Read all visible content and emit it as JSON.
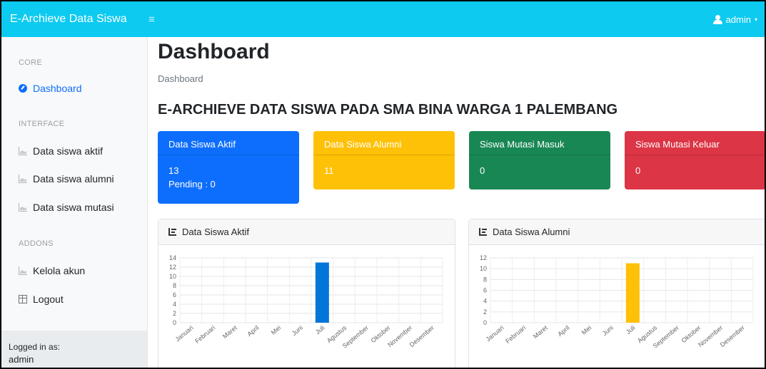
{
  "navbar": {
    "brand": "E-Archieve Data Siswa",
    "toggle_icon": "menu-icon",
    "user_label": "admin",
    "user_icon": "user-icon",
    "caret": "▾"
  },
  "sidebar": {
    "sections": {
      "core": "CORE",
      "interface": "INTERFACE",
      "addons": "ADDONS"
    },
    "items": [
      {
        "label": "Dashboard",
        "icon": "dashboard-icon",
        "active": true
      },
      {
        "label": "Data siswa aktif",
        "icon": "area-chart-icon"
      },
      {
        "label": "Data siswa alumni",
        "icon": "area-chart-icon"
      },
      {
        "label": "Data siswa mutasi",
        "icon": "area-chart-icon"
      },
      {
        "label": "Kelola akun",
        "icon": "area-chart-icon"
      },
      {
        "label": "Logout",
        "icon": "table-icon"
      }
    ],
    "footer": {
      "caption": "Logged in as:",
      "name": "admin"
    }
  },
  "main": {
    "title": "Dashboard",
    "breadcrumb": "Dashboard",
    "headline": "E-ARCHIEVE DATA SISWA PADA SMA BINA WARGA 1 PALEMBANG",
    "cards": [
      {
        "title": "Data Siswa Aktif",
        "value": "13",
        "extra": "Pending : 0",
        "color": "#0d6efd"
      },
      {
        "title": "Data Siswa Alumni",
        "value": "11",
        "color": "#ffc107"
      },
      {
        "title": "Siswa Mutasi Masuk",
        "value": "0",
        "color": "#198754"
      },
      {
        "title": "Siswa Mutasi Keluar",
        "value": "0",
        "color": "#dc3545"
      }
    ],
    "panels": {
      "left_title": "Data Siswa Aktif",
      "right_title": "Data Siswa Alumni"
    }
  },
  "chart_data": [
    {
      "type": "bar",
      "categories": [
        "Januari",
        "Februari",
        "Maret",
        "April",
        "Mei",
        "Juni",
        "Juli",
        "Agustus",
        "September",
        "Oktober",
        "November",
        "Desember"
      ],
      "values": [
        0,
        0,
        0,
        0,
        0,
        0,
        13,
        0,
        0,
        0,
        0,
        0
      ],
      "ylim": [
        0,
        14
      ],
      "yticks": [
        0,
        2,
        4,
        6,
        8,
        10,
        12,
        14
      ],
      "color": "#0275d8",
      "grid": true
    },
    {
      "type": "bar",
      "categories": [
        "Januari",
        "Februari",
        "Maret",
        "April",
        "Mei",
        "Juni",
        "Juli",
        "Agustus",
        "September",
        "Oktober",
        "November",
        "Desember"
      ],
      "values": [
        0,
        0,
        0,
        0,
        0,
        0,
        11,
        0,
        0,
        0,
        0,
        0
      ],
      "ylim": [
        0,
        12
      ],
      "yticks": [
        0,
        2,
        4,
        6,
        8,
        10,
        12
      ],
      "color": "#ffc107",
      "grid": true
    }
  ]
}
